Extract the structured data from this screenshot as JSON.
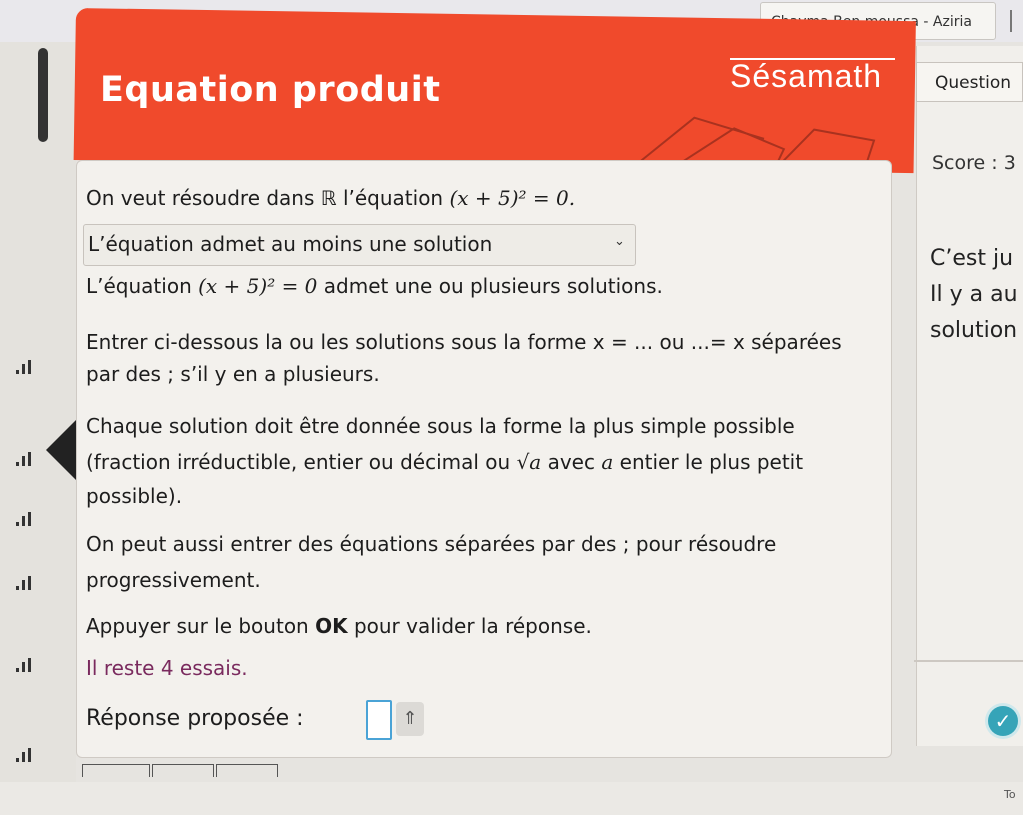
{
  "user": {
    "name": "Chayma Ben moussa - Aziria"
  },
  "header": {
    "title": "Equation produit",
    "brand": "Sésamath"
  },
  "sidepanel": {
    "question_label": "Question",
    "score_label": "Score : 3",
    "feedback_lines": [
      "C’est ju",
      "Il y a au",
      "solution"
    ],
    "validate_icon": "check-icon"
  },
  "question": {
    "intro_prefix": "On veut résoudre dans ℝ l’équation",
    "intro_equation": "(x + 5)² = 0.",
    "selected_answer": "L’équation admet au moins une solution",
    "statement_prefix": "L’équation",
    "statement_equation": "(x + 5)² = 0",
    "statement_suffix": "admet une ou plusieurs solutions.",
    "instr1_line1": "Entrer ci-dessous la ou les solutions sous la forme x = ... ou ...= x séparées",
    "instr1_line2": "par des ; s’il y en a plusieurs.",
    "instr2_line1": "Chaque solution doit être donnée sous la forme la plus simple possible",
    "instr2_line2_a": "(fraction irréductible, entier ou décimal ou",
    "instr2_line2_math": "√a",
    "instr2_line2_b": "avec",
    "instr2_line2_var": "a",
    "instr2_line2_c": "entier le plus petit",
    "instr2_line3": "possible).",
    "instr3_line1": "On peut aussi entrer des équations séparées par des ; pour résoudre",
    "instr3_line2": "progressivement.",
    "instr4_prefix": "Appuyer sur le bouton",
    "instr4_bold": "OK",
    "instr4_suffix": "pour valider la réponse.",
    "tries": "Il reste 4 essais.",
    "answer_label": "Réponse proposée :",
    "answer_value": "",
    "keyboard_icon": "keyboard-toggle-icon"
  },
  "footer": {
    "corner_text": "To"
  },
  "colors": {
    "header": "#f04a2c",
    "input_border": "#4aa3d6",
    "validate": "#36a4b8",
    "tries": "#7a2a5e"
  }
}
